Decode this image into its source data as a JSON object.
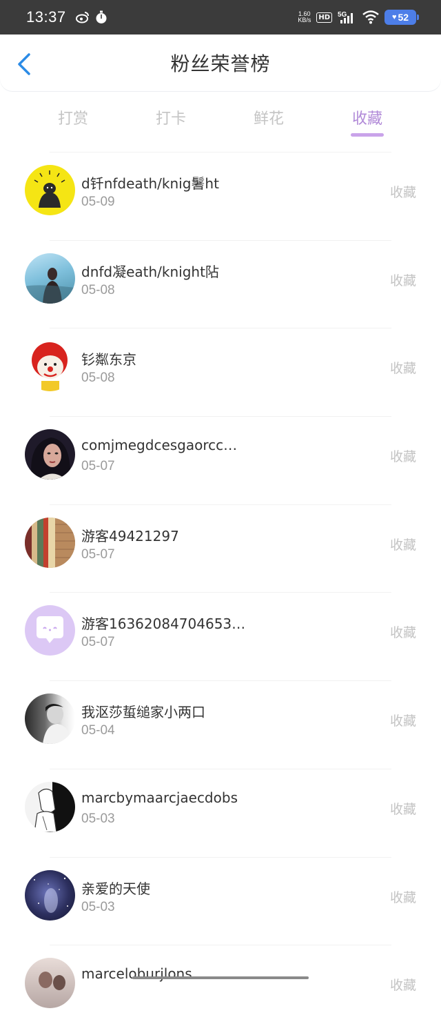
{
  "status_bar": {
    "time": "13:37",
    "net_speed_value": "1.60",
    "net_speed_unit": "KB/s",
    "hd": "HD",
    "network": "5G",
    "battery": "52"
  },
  "header": {
    "title": "粉丝荣誉榜"
  },
  "tabs": [
    {
      "label": "打赏",
      "active": false
    },
    {
      "label": "打卡",
      "active": false
    },
    {
      "label": "鲜花",
      "active": false
    },
    {
      "label": "收藏",
      "active": true
    }
  ],
  "colors": {
    "accent": "#b18ad8",
    "tab_inactive": "#c4c4c4"
  },
  "list": [
    {
      "nickname": "d钎nfdeath/knig鬐ht",
      "date": "05-09",
      "action": "收藏",
      "avatar": "yellow-bear-avatar"
    },
    {
      "nickname": "dnfd凝eath/knight阽",
      "date": "05-08",
      "action": "收藏",
      "avatar": "girl-sky-avatar"
    },
    {
      "nickname": "钐粼东京",
      "date": "05-08",
      "action": "收藏",
      "avatar": "clown-avatar"
    },
    {
      "nickname": "comjmegdcesgaorcc…",
      "date": "05-07",
      "action": "收藏",
      "avatar": "woman-portrait-avatar"
    },
    {
      "nickname": "游客49421297",
      "date": "05-07",
      "action": "收藏",
      "avatar": "bookshelf-avatar"
    },
    {
      "nickname": "游客16362084704653…",
      "date": "05-07",
      "action": "收藏",
      "avatar": "default-chat-avatar"
    },
    {
      "nickname": "我沤莎蜇缒家小两口",
      "date": "05-04",
      "action": "收藏",
      "avatar": "bw-photo-avatar"
    },
    {
      "nickname": "marcbymaarcjaecdobs",
      "date": "05-03",
      "action": "收藏",
      "avatar": "sketch-avatar"
    },
    {
      "nickname": "亲爱的天使",
      "date": "05-03",
      "action": "收藏",
      "avatar": "galaxy-avatar"
    },
    {
      "nickname": "marceloburjlons",
      "date": "",
      "action": "收藏",
      "avatar": "photo-avatar"
    }
  ]
}
